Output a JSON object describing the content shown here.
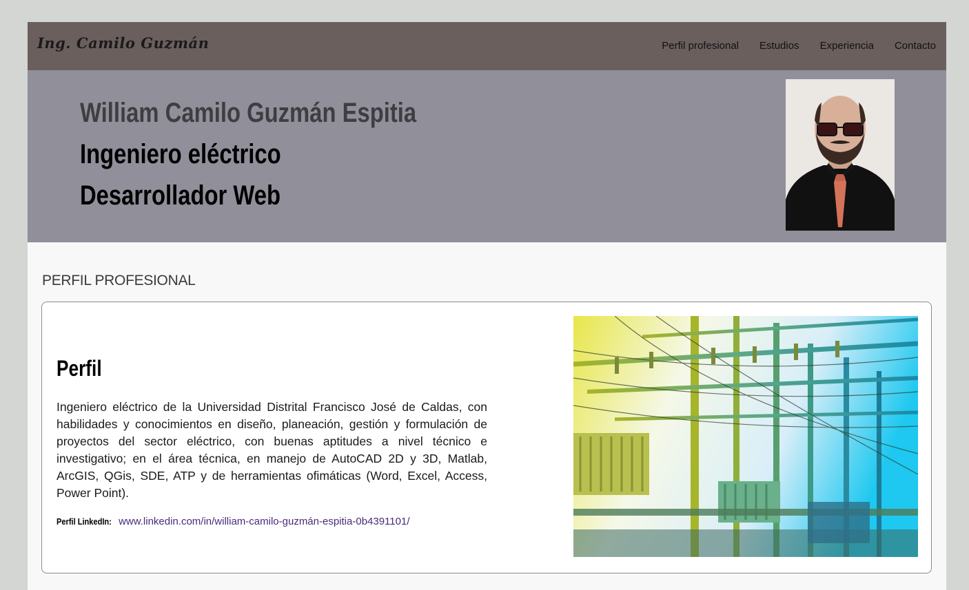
{
  "navbar": {
    "brand": "Ing. Camilo Guzmán",
    "links": [
      "Perfil profesional",
      "Estudios",
      "Experiencia",
      "Contacto"
    ]
  },
  "hero": {
    "name": "William Camilo Guzmán Espitia",
    "title1": "Ingeniero eléctrico",
    "title2": "Desarrollador Web"
  },
  "profile": {
    "section_title": "PERFIL PROFESIONAL",
    "heading": "Perfil",
    "description": "Ingeniero eléctrico de la Universidad Distrital Francisco José de Caldas, con habilidades y conocimientos en diseño, planeación, gestión y formulación de proyectos del sector eléctrico, con buenas aptitudes a nivel técnico e investigativo; en el área técnica, en manejo de AutoCAD 2D y 3D, Matlab, ArcGIS, QGis, SDE, ATP y de herramientas ofimáticas (Word, Excel, Access, Power Point).",
    "linkedin_label": "Perfil LinkedIn:",
    "linkedin_url": "www.linkedin.com/in/william-camilo-guzmán-espitia-0b4391101/"
  },
  "colors": {
    "page_bg": "#d3d6d2",
    "navbar": "#6b5f5e",
    "hero": "#908f9a",
    "link": "#4a2b7a"
  }
}
